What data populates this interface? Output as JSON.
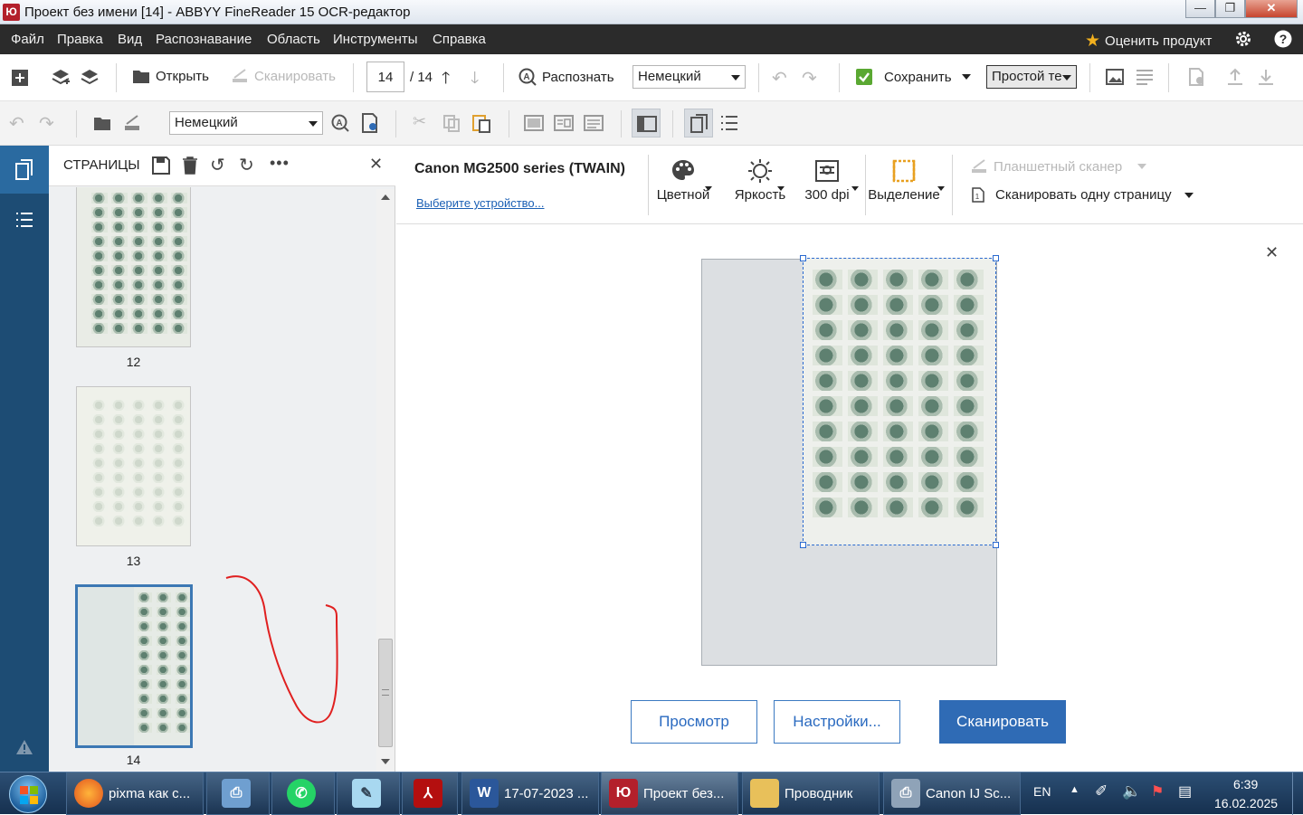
{
  "window": {
    "title": "Проект без имени [14] - ABBYY FineReader 15 OCR-редактор",
    "app_icon_label": "Ю",
    "minimize": "—",
    "maximize": "❐",
    "close": "✕"
  },
  "menubar": {
    "items": [
      "Файл",
      "Правка",
      "Вид",
      "Распознавание",
      "Область",
      "Инструменты",
      "Справка"
    ],
    "rate_product": "Оценить продукт"
  },
  "toolbar1": {
    "open": "Открыть",
    "scan": "Сканировать",
    "page_current": "14",
    "page_total": "/ 14",
    "recognize": "Распознать",
    "language": "Немецкий",
    "save": "Сохранить",
    "save_format": "Простой те"
  },
  "toolbar2": {
    "language": "Немецкий"
  },
  "pages_panel": {
    "title": "СТРАНИЦЫ",
    "pages": [
      {
        "number": "12"
      },
      {
        "number": "13"
      },
      {
        "number": "14"
      }
    ]
  },
  "scanner": {
    "device_name": "Canon MG2500 series (TWAIN)",
    "choose_device": "Выберите устройство...",
    "color": "Цветной",
    "brightness": "Яркость",
    "resolution": "300 dpi",
    "selection": "Выделение",
    "flatbed": "Планшетный сканер",
    "scan_one_page": "Сканировать одну страницу",
    "preview_button": "Просмотр",
    "settings_button": "Настройки...",
    "scan_button": "Сканировать"
  },
  "taskbar": {
    "items": [
      {
        "label": "pixma как с..."
      },
      {
        "label": "17-07-2023 ..."
      },
      {
        "label": "Проект без..."
      },
      {
        "label": "Проводник"
      },
      {
        "label": "Canon IJ Sc..."
      }
    ],
    "language": "EN",
    "time": "6:39",
    "date": "16.02.2025"
  },
  "colors": {
    "accent": "#2f6bb5",
    "sidebar": "#1d4c74",
    "menubar": "#2b2b2b",
    "annotation": "#e02020"
  }
}
